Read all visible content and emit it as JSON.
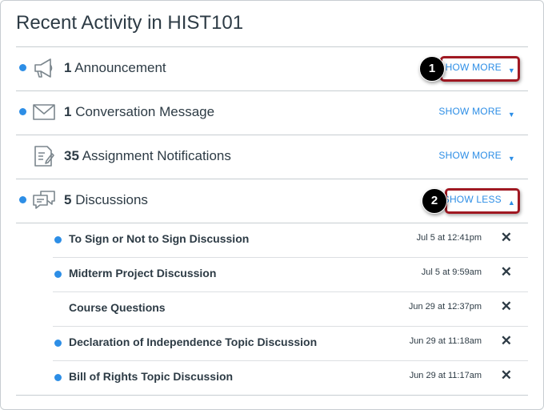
{
  "title": "Recent Activity in HIST101",
  "colors": {
    "accent": "#2d8ee6",
    "callout": "#a01822",
    "text": "#2d3b45"
  },
  "activity": [
    {
      "count": "1",
      "label": "Announcement",
      "icon": "megaphone-icon",
      "toggle": "SHOW MORE",
      "caret": "▼",
      "unread": true
    },
    {
      "count": "1",
      "label": "Conversation Message",
      "icon": "envelope-icon",
      "toggle": "SHOW MORE",
      "caret": "▼",
      "unread": true
    },
    {
      "count": "35",
      "label": "Assignment Notifications",
      "icon": "assignment-icon",
      "toggle": "SHOW MORE",
      "caret": "▼",
      "unread": false
    },
    {
      "count": "5",
      "label": "Discussions",
      "icon": "discussion-icon",
      "toggle": "SHOW LESS",
      "caret": "▲",
      "unread": true
    }
  ],
  "discussions": [
    {
      "title": "To Sign or Not to Sign Discussion",
      "date": "Jul 5 at 12:41pm",
      "unread": true
    },
    {
      "title": "Midterm Project Discussion",
      "date": "Jul 5 at 9:59am",
      "unread": true
    },
    {
      "title": "Course Questions",
      "date": "Jun 29 at 12:37pm",
      "unread": false
    },
    {
      "title": "Declaration of Independence Topic Discussion",
      "date": "Jun 29 at 11:18am",
      "unread": true
    },
    {
      "title": "Bill of Rights Topic Discussion",
      "date": "Jun 29 at 11:17am",
      "unread": true
    }
  ],
  "close_glyph": "✕",
  "callouts": [
    "1",
    "2"
  ]
}
